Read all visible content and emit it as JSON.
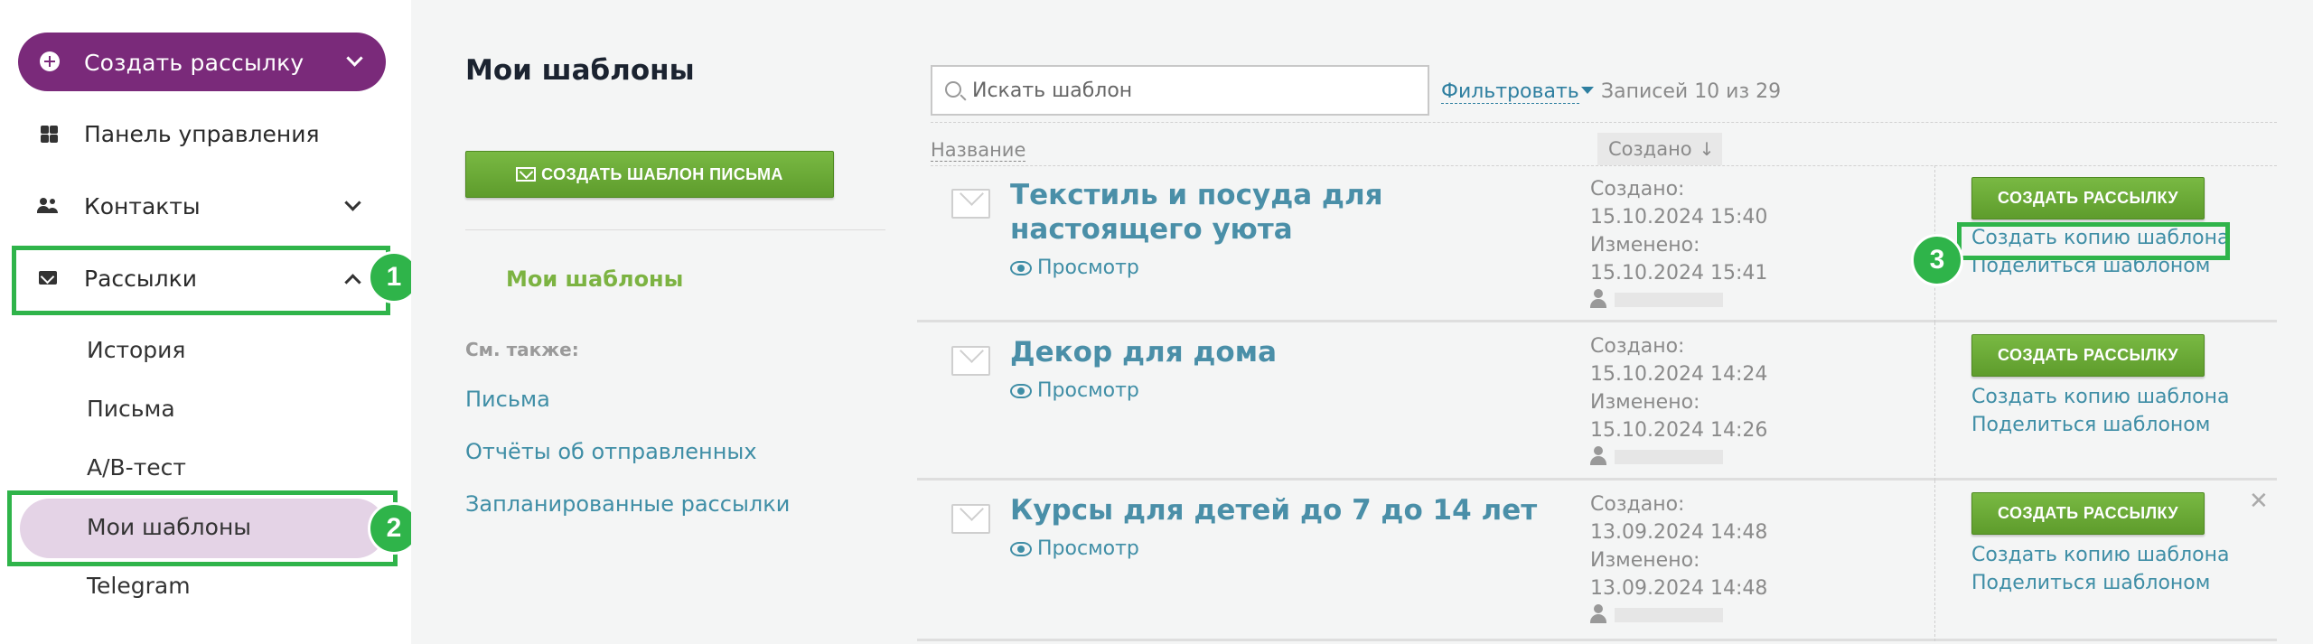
{
  "sidebar": {
    "create_button": "Создать рассылку",
    "items": [
      {
        "label": "Панель управления"
      },
      {
        "label": "Контакты"
      },
      {
        "label": "Рассылки"
      }
    ],
    "subitems": [
      "История",
      "Письма",
      "A/B-тест",
      "Мои шаблоны",
      "Telegram"
    ]
  },
  "badges": [
    "1",
    "2",
    "3"
  ],
  "middle": {
    "title": "Мои шаблоны",
    "create_template_button": "СОЗДАТЬ ШАБЛОН ПИСЬМА",
    "active_link": "Мои шаблоны",
    "see_also_label": "См. также:",
    "links": [
      "Письма",
      "Отчёты об отправленных",
      "Запланированные рассылки"
    ]
  },
  "main": {
    "search_placeholder": "Искать шаблон",
    "filter_label": "Фильтровать",
    "records": "Записей 10 из 29",
    "col_name": "Название",
    "col_created": "Создано",
    "sort_arrow": "↓",
    "view_label": "Просмотр",
    "create_mailing_button": "СОЗДАТЬ РАССЫЛКУ",
    "copy_template": "Создать копию шаблона",
    "share_template": "Поделиться шаблоном",
    "created_label": "Создано:",
    "modified_label": "Изменено:",
    "rows": [
      {
        "title": "Текстиль и посуда для настоящего уюта",
        "created": "15.10.2024 15:40",
        "modified": "15.10.2024 15:41"
      },
      {
        "title": "Декор для дома",
        "created": "15.10.2024 14:24",
        "modified": "15.10.2024 14:26"
      },
      {
        "title": "Курсы для детей до 7 до 14 лет",
        "created": "13.09.2024 14:48",
        "modified": "13.09.2024 14:48"
      }
    ]
  },
  "colors": {
    "brand_purple": "#7a2a7a",
    "active_bg": "#e4d3e6",
    "green_button": "#6aab36",
    "highlight_green": "#2fb44a",
    "link_blue": "#3f8ea6"
  }
}
